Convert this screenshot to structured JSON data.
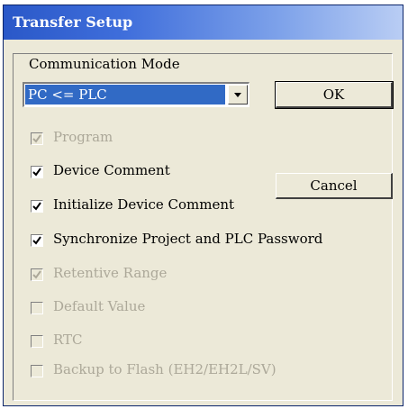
{
  "window": {
    "title": "Transfer Setup"
  },
  "communication": {
    "label": "Communication Mode",
    "selected": "PC <= PLC"
  },
  "buttons": {
    "ok": "OK",
    "cancel": "Cancel"
  },
  "options": [
    {
      "label": "Program",
      "checked": true,
      "enabled": false
    },
    {
      "label": "Device Comment",
      "checked": true,
      "enabled": true
    },
    {
      "label": "Initialize Device Comment",
      "checked": true,
      "enabled": true
    },
    {
      "label": "Synchronize Project and PLC Password",
      "checked": true,
      "enabled": true
    },
    {
      "label": "Retentive Range",
      "checked": true,
      "enabled": false
    },
    {
      "label": "Default Value",
      "checked": false,
      "enabled": false
    },
    {
      "label": "RTC",
      "checked": false,
      "enabled": false
    },
    {
      "label": "Backup to Flash (EH2/EH2L/SV)",
      "checked": false,
      "enabled": false
    }
  ]
}
